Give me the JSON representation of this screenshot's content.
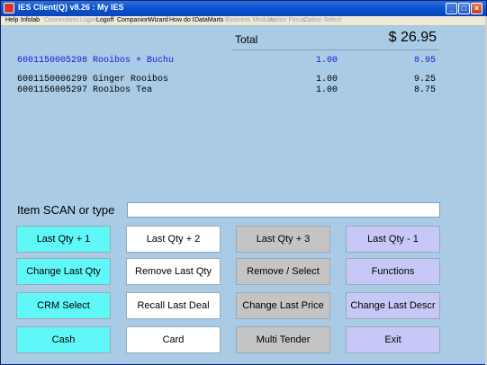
{
  "window": {
    "title": "IES Client(Q) v8.26 : My IES",
    "minimize": "_",
    "maximize": "□",
    "close": "×"
  },
  "menu": [
    {
      "label": "Help",
      "enabled": true
    },
    {
      "label": "Infolab",
      "enabled": true
    },
    {
      "label": "Connections",
      "enabled": false
    },
    {
      "label": "Logon",
      "enabled": false
    },
    {
      "label": "Logoff",
      "enabled": true
    },
    {
      "label": "Companion",
      "enabled": true
    },
    {
      "label": "Wizard",
      "enabled": true
    },
    {
      "label": "How do I",
      "enabled": true
    },
    {
      "label": "DataMarts",
      "enabled": true
    },
    {
      "label": "Business Modules",
      "enabled": false
    },
    {
      "label": "Action Focus",
      "enabled": false
    },
    {
      "label": "Option Select",
      "enabled": false
    }
  ],
  "total": {
    "label": "Total",
    "value": "$ 26.95"
  },
  "lines": [
    {
      "code": "6001150005298 Rooibos + Buchu",
      "qty": "1.00",
      "price": "8.95",
      "active": true
    },
    {
      "code": "6001150006299 Ginger Rooibos",
      "qty": "1.00",
      "price": "9.25",
      "active": false
    },
    {
      "code": "6001156005297 Rooibos Tea",
      "qty": "1.00",
      "price": "8.75",
      "active": false
    }
  ],
  "scan": {
    "label": "Item SCAN or type",
    "value": ""
  },
  "buttons": {
    "last_qty_plus_1": "Last Qty + 1",
    "last_qty_plus_2": "Last Qty + 2",
    "last_qty_plus_3": "Last Qty + 3",
    "last_qty_minus_1": "Last Qty - 1",
    "change_last_qty": "Change Last Qty",
    "remove_last_qty": "Remove Last Qty",
    "remove_select": "Remove / Select",
    "functions": "Functions",
    "crm_select": "CRM Select",
    "recall_last_deal": "Recall Last Deal",
    "change_last_price": "Change Last Price",
    "change_last_descr": "Change Last Descr",
    "cash": "Cash",
    "card": "Card",
    "multi_tender": "Multi Tender",
    "exit": "Exit"
  },
  "colors": {
    "background": "#a9cbe6",
    "cyan_button": "#5ff7f7",
    "gray_button": "#c4c4c4",
    "lavender_button": "#c8c8f8",
    "active_line": "#1a1ad6"
  }
}
